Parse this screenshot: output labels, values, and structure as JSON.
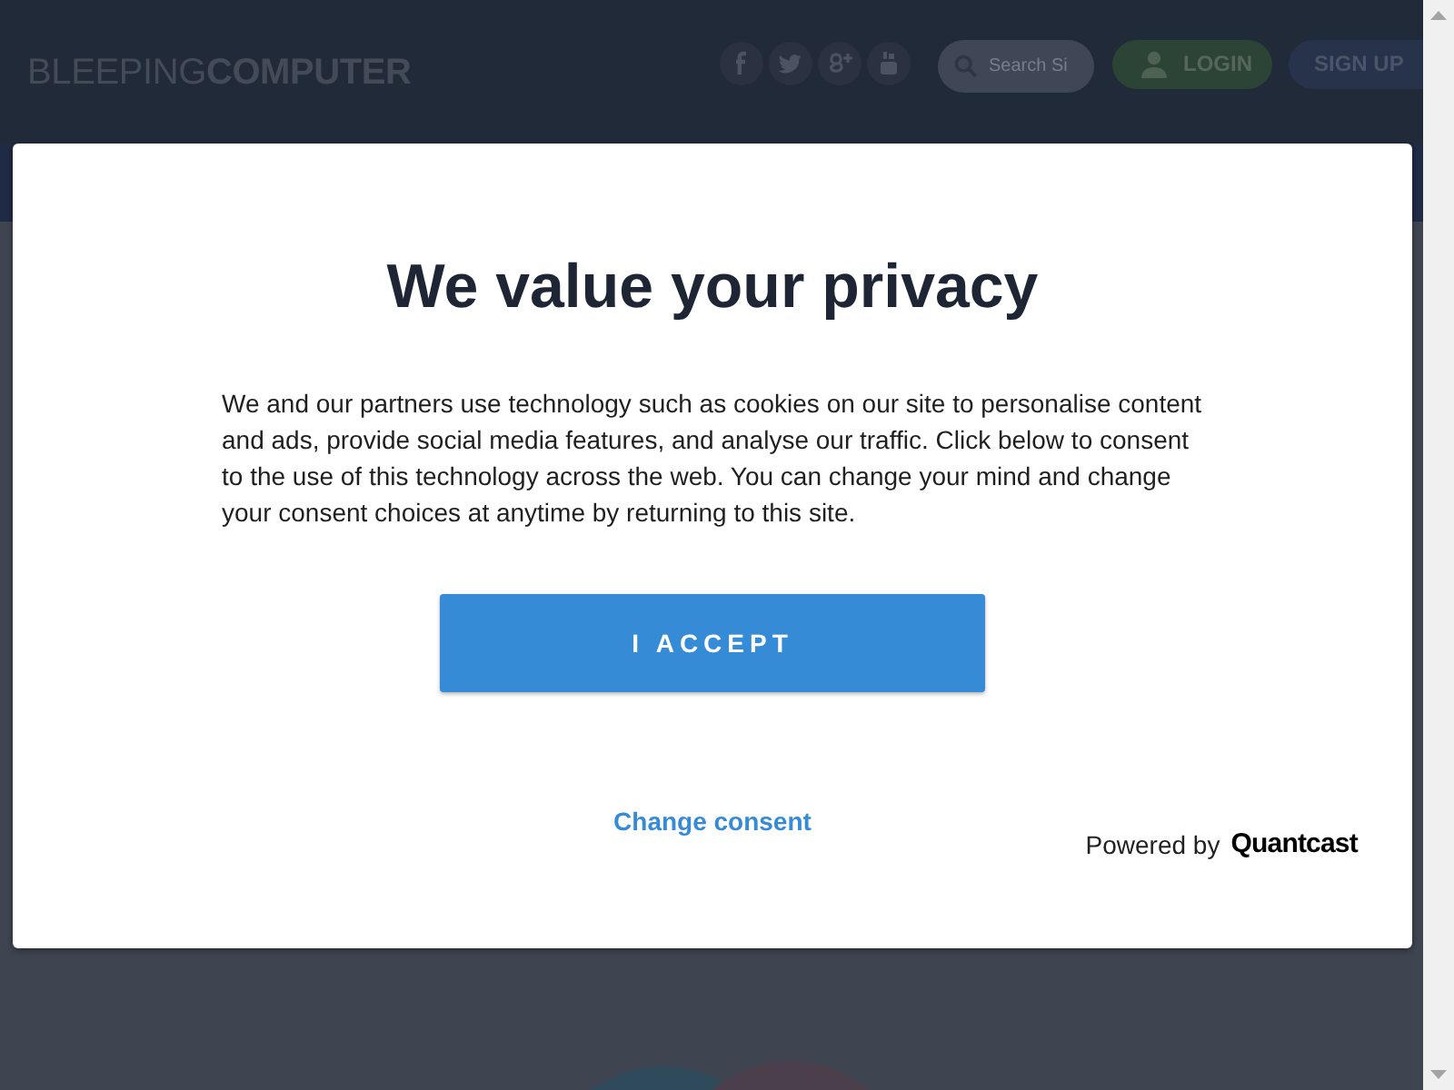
{
  "header": {
    "logo": "BLEEPING**COMPUTER**",
    "search": {
      "placeholder": "Search Si"
    },
    "buttons": [
      {
        "kind": "login",
        "label": "LOGIN"
      },
      {
        "kind": "signup",
        "label": "SIGN UP"
      }
    ]
  },
  "consent_dialog": {
    "title": "We value your privacy",
    "body": "We and our partners use technology such as cookies on our site to personalise content and ads, provide social media features, and analyse our traffic. Click below to consent to the use of this technology across the web. You can change your mind and change your consent choices at anytime by returning to this site.",
    "accept_button": "I ACCEPT",
    "change_consent_link": "Change consent",
    "powered_by": "Powered by",
    "brand": "Quantcast"
  }
}
